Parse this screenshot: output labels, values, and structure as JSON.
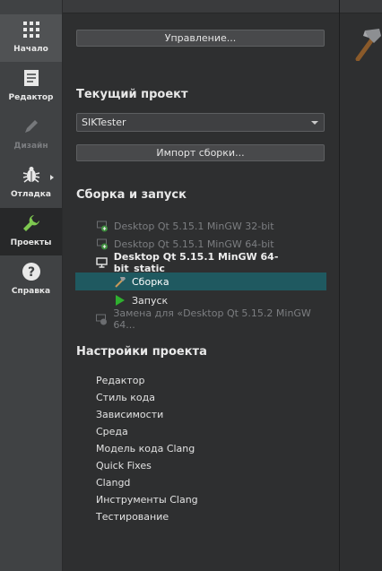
{
  "modebar": {
    "items": [
      {
        "label": "Начало",
        "icon": "grid-icon"
      },
      {
        "label": "Редактор",
        "icon": "document-icon"
      },
      {
        "label": "Дизайн",
        "icon": "pen-icon"
      },
      {
        "label": "Отладка",
        "icon": "bug-icon"
      },
      {
        "label": "Проекты",
        "icon": "wrench-icon"
      },
      {
        "label": "Справка",
        "icon": "help-icon"
      }
    ]
  },
  "panel": {
    "manage_button": "Управление...",
    "current_project_heading": "Текущий проект",
    "current_project_value": "SIKTester",
    "import_button": "Импорт сборки...",
    "build_run_heading": "Сборка и запуск",
    "kits": [
      {
        "label": "Desktop Qt 5.15.1 MinGW 32-bit",
        "state": "disabled"
      },
      {
        "label": "Desktop Qt 5.15.1 MinGW 64-bit",
        "state": "disabled"
      },
      {
        "label": "Desktop Qt 5.15.1 MinGW 64-bit_static",
        "state": "active"
      },
      {
        "label": "Сборка",
        "state": "selected-child"
      },
      {
        "label": "Запуск",
        "state": "child"
      },
      {
        "label": "Замена для «Desktop Qt 5.15.2 MinGW 64...",
        "state": "disabled"
      }
    ],
    "project_settings_heading": "Настройки проекта",
    "settings_items": [
      "Редактор",
      "Стиль кода",
      "Зависимости",
      "Среда",
      "Модель кода Clang",
      "Quick Fixes",
      "Clangd",
      "Инструменты Clang",
      "Тестирование"
    ]
  },
  "colors": {
    "accent_selected": "#1f5960",
    "add_kit_green": "#3d8f3d",
    "run_green": "#2fb02f"
  }
}
